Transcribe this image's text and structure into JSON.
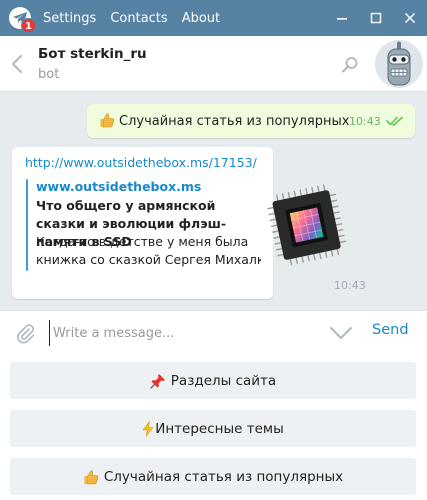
{
  "titlebar": {
    "unread_badge": "1",
    "menu": [
      "Settings",
      "Contacts",
      "About"
    ]
  },
  "chat": {
    "title": "Бот sterkin_ru",
    "subtitle": "bot"
  },
  "messages": {
    "outgoing": {
      "text": "Случайная статья из популярных",
      "time": "10:43"
    },
    "incoming": {
      "link": "http://www.outsidethebox.ms/17153/",
      "preview_site": "www.outsidethebox.ms",
      "preview_title": "Что общего у армянской сказки и эволюции флэш-памяти в SSD",
      "preview_desc_line1": "Когда-то в детстве у меня была",
      "preview_desc_line2": "книжка со сказкой Сергея Михалк...",
      "time": "10:43"
    }
  },
  "composer": {
    "placeholder": "Write a message...",
    "send_label": "Send"
  },
  "keyboard": {
    "buttons": [
      {
        "label": "Разделы сайта",
        "icon": "pushpin-icon"
      },
      {
        "label": "Интересные темы",
        "icon": "lightning-icon"
      },
      {
        "label": "Случайная статья из популярных",
        "icon": "thumbs-up-icon"
      }
    ]
  },
  "colors": {
    "titlebar": "#5682a3",
    "accent": "#168acd",
    "outgoing_bubble": "#effdde",
    "chat_background": "#e6ebee"
  }
}
